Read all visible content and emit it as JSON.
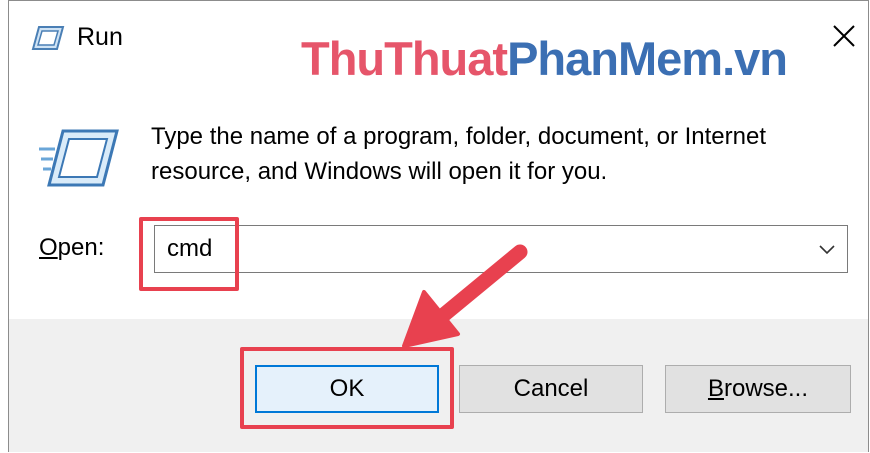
{
  "window": {
    "title": "Run"
  },
  "watermark": {
    "part1": "ThuThuat",
    "part2": "PhanMem",
    "part3": ".vn"
  },
  "dialog": {
    "description": "Type the name of a program, folder, document, or Internet resource, and Windows will open it for you.",
    "open_label_mnemonic": "O",
    "open_label_rest": "pen:",
    "open_value": "cmd"
  },
  "buttons": {
    "ok": "OK",
    "cancel": "Cancel",
    "browse_mnemonic": "B",
    "browse_rest": "rowse..."
  },
  "colors": {
    "highlight": "#e8414f",
    "accent": "#0078d7",
    "footer_bg": "#f0f0f0",
    "watermark_red": "#e6556a",
    "watermark_blue": "#3b6fb3"
  },
  "icons": [
    "run-icon",
    "close-icon",
    "run-large-icon",
    "chevron-down-icon",
    "pointer-arrow-icon"
  ]
}
